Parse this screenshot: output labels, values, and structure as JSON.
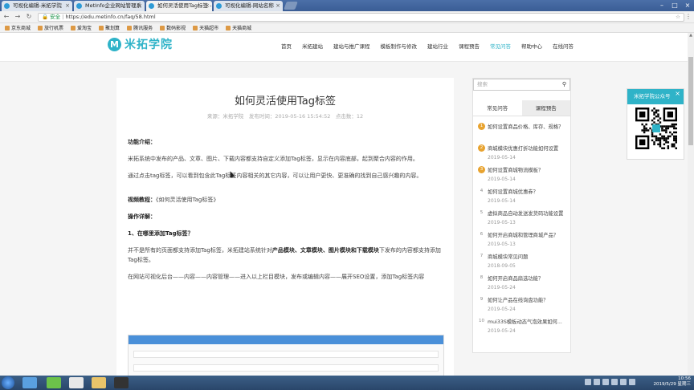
{
  "browser": {
    "tabs": [
      {
        "label": "可视化编辑-米拓学院",
        "active": false
      },
      {
        "label": "MetInfo企业网站管理系",
        "active": false
      },
      {
        "label": "如何灵活使用Tag标签 -",
        "active": true
      },
      {
        "label": "可视化编辑-网站名称",
        "active": false
      }
    ],
    "secure_label": "安全",
    "url": "https://edu.metinfo.cn/faq/58.html",
    "bookmarks": [
      "京东商城",
      "旅行机票",
      "爱淘宝",
      "聚划算",
      "腾讯服务",
      "数码影视",
      "天猫超市",
      "天猫商城"
    ]
  },
  "site": {
    "logo_mark": "M",
    "logo_text": "米拓学院",
    "nav": [
      {
        "label": "首页",
        "current": false
      },
      {
        "label": "米拓建站",
        "current": false
      },
      {
        "label": "建站与推广课程",
        "current": false
      },
      {
        "label": "模板制作与修改",
        "current": false
      },
      {
        "label": "建站行业",
        "current": false
      },
      {
        "label": "课程预告",
        "current": false
      },
      {
        "label": "常见问答",
        "current": true
      },
      {
        "label": "帮助中心",
        "current": false
      },
      {
        "label": "在线问答",
        "current": false
      }
    ]
  },
  "article": {
    "title": "如何灵活使用Tag标签",
    "meta": "来源：米拓学院　发布时间：2019-05-16 15:54:52　点击数：12",
    "h_intro": "功能介绍：",
    "p1": "米拓系统中发布的产品、文章、图片、下载内容都支持自定义添加Tag标签，显示在内容底部，起到聚合内容的作用。",
    "p2": "通过点击tag标签，可以看到包含此Tag标签内容相关的其它内容，可以让用户更快、更准确的找到自己感兴趣的内容。",
    "video_label": "视频教程：",
    "video_title": "《如何灵活使用Tag标签》",
    "h_steps": "操作详解：",
    "h_step1": "1、在哪里添加Tag标签？",
    "p3_a": "并不是所有的页面都支持添加Tag标签，米拓建站系统针对",
    "p3_b": "产品模块、文章模块、图片模块和下载模块",
    "p3_c": "下发布的内容都支持添加Tag标签。",
    "p4": "在网站可视化后台——内容——内容管理——进入以上栏目模块，发布或编辑内容——展开SEO设置，添加Tag标签内容"
  },
  "sidebar": {
    "search_placeholder": "搜索",
    "tabs": [
      {
        "label": "常见问答",
        "current": true
      },
      {
        "label": "课程预告",
        "current": false
      }
    ],
    "items": [
      {
        "num": "1",
        "hot": true,
        "title": "如何设置商品价格、库存、规格？",
        "date": ""
      },
      {
        "num": "2",
        "hot": true,
        "title": "商城模块优惠打折功能如何设置",
        "date": "2019-05-14"
      },
      {
        "num": "3",
        "hot": true,
        "title": "如何设置商城物流模板？",
        "date": "2019-05-14"
      },
      {
        "num": "4",
        "hot": false,
        "title": "如何设置商城优惠券？",
        "date": "2019-05-14"
      },
      {
        "num": "5",
        "hot": false,
        "title": "虚拟商品自动发送发货码功能设置",
        "date": "2019-05-13"
      },
      {
        "num": "6",
        "hot": false,
        "title": "如何开启商城和管理商城产品？",
        "date": "2019-05-13"
      },
      {
        "num": "7",
        "hot": false,
        "title": "商城模块常见问题",
        "date": "2018-09-05"
      },
      {
        "num": "8",
        "hot": false,
        "title": "如何开启商品扇选功能？",
        "date": "2019-05-24"
      },
      {
        "num": "9",
        "hot": false,
        "title": "如何让产品在线询盘功能？",
        "date": "2019-05-24"
      },
      {
        "num": "10",
        "hot": false,
        "title": "mui33S模板动态气泡效果如何...",
        "date": "2019-05-24"
      }
    ]
  },
  "qr_popup": {
    "title": "米拓学院公众号",
    "close": "×"
  },
  "taskbar": {
    "time": "10:56",
    "date": "2019/5/29 星期三"
  }
}
